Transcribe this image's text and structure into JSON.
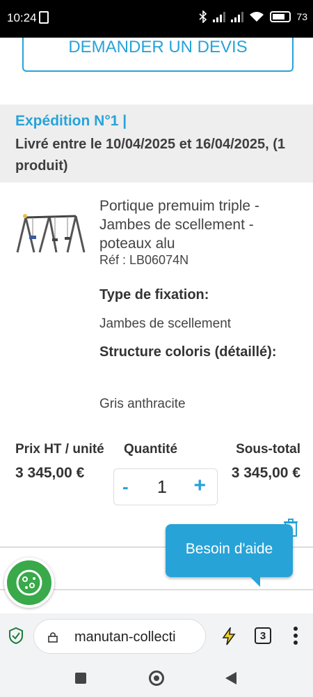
{
  "status": {
    "time": "10:24",
    "battery": "73"
  },
  "quote": {
    "label": "DEMANDER UN DEVIS"
  },
  "shipping": {
    "title": "Expédition N°1 |",
    "dates": "Livré entre le 10/04/2025 et 16/04/2025, (1 produit)"
  },
  "product": {
    "name": "Portique premuim triple - Jambes de scellement - poteaux alu",
    "ref": "Réf : LB06074N",
    "options": [
      {
        "label": "Type de fixation:",
        "value": "Jambes de scellement"
      },
      {
        "label": "Structure coloris (détaillé):",
        "value": "Gris anthracite"
      }
    ]
  },
  "columns": {
    "price_label": "Prix HT / unité",
    "qty_label": "Quantité",
    "subtotal_label": "Sous-total"
  },
  "line": {
    "unit_price": "3 345,00 €",
    "quantity": "1",
    "subtotal": "3 345,00 €",
    "minus": "-",
    "plus": "+"
  },
  "help": {
    "label": "Besoin d'aide"
  },
  "browser": {
    "url": "manutan-collecti",
    "tab_count": "3"
  },
  "colors": {
    "accent": "#27a3d8",
    "cookie": "#39a94a"
  }
}
